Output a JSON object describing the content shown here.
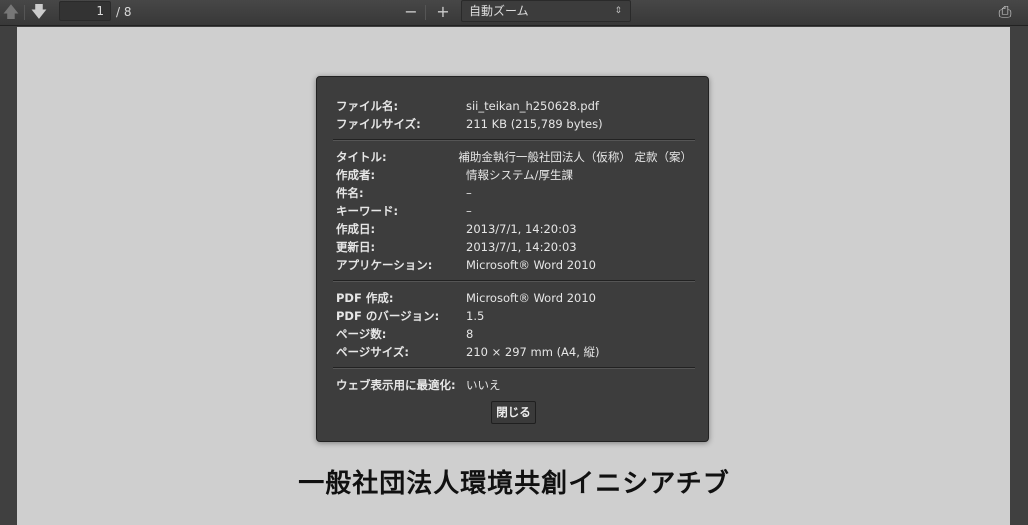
{
  "toolbar": {
    "page_current": "1",
    "page_total": "/ 8",
    "zoom_minus": "−",
    "zoom_plus": "+",
    "zoom_value": "自動ズーム",
    "zoom_arrow": "⇕",
    "prev_icon": "🡅",
    "next_icon": "🡇",
    "print_icon": "⎙"
  },
  "dialog": {
    "groups": [
      [
        {
          "k": "ファイル名:",
          "v": "sii_teikan_h250628.pdf"
        },
        {
          "k": "ファイルサイズ:",
          "v": "211 KB (215,789 bytes)"
        }
      ],
      [
        {
          "k": "タイトル:",
          "v": "補助金執行一般社団法人（仮称） 定款（案）"
        },
        {
          "k": "作成者:",
          "v": "情報システム/厚生課"
        },
        {
          "k": "件名:",
          "v": "–"
        },
        {
          "k": "キーワード:",
          "v": "–"
        },
        {
          "k": "作成日:",
          "v": "2013/7/1, 14:20:03"
        },
        {
          "k": "更新日:",
          "v": "2013/7/1, 14:20:03"
        },
        {
          "k": "アプリケーション:",
          "v": "Microsoft® Word 2010"
        }
      ],
      [
        {
          "k": "PDF 作成:",
          "v": "Microsoft® Word 2010"
        },
        {
          "k": "PDF のバージョン:",
          "v": "1.5"
        },
        {
          "k": "ページ数:",
          "v": "8"
        },
        {
          "k": "ページサイズ:",
          "v": "210 × 297 mm (A4, 縦)"
        }
      ],
      [
        {
          "k": "ウェブ表示用に最適化:",
          "v": "いいえ"
        }
      ]
    ],
    "close_label": "閉じる"
  },
  "document": {
    "title": "一般社団法人環境共創イニシアチブ"
  }
}
